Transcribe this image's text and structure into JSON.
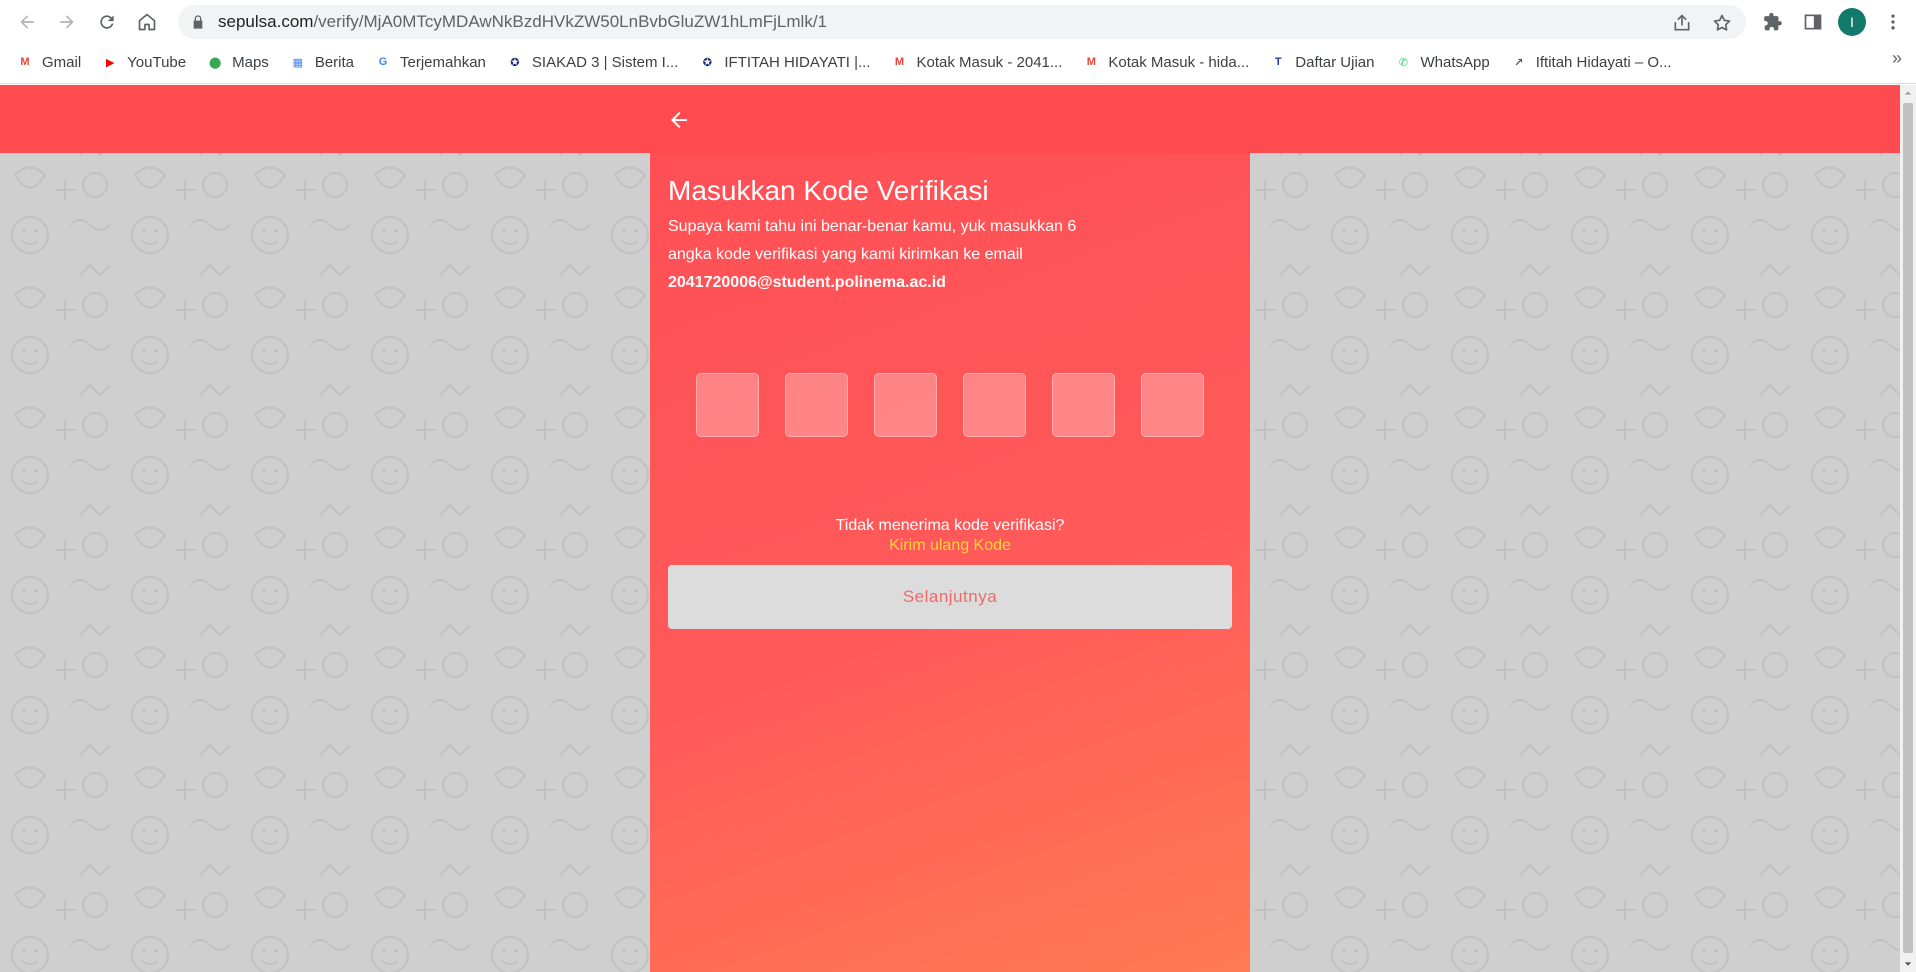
{
  "browser": {
    "url_domain": "sepulsa.com",
    "url_path": "/verify/MjA0MTcyMDAwNkBzdHVkZW50LnBvbGluZW1hLmFjLmlk/1",
    "profile_initial": "I",
    "icons": {
      "back": "arrow-left-icon",
      "forward": "arrow-right-icon",
      "reload": "reload-icon",
      "home": "home-icon",
      "lock": "lock-icon",
      "share": "share-icon",
      "star": "star-icon",
      "extensions": "puzzle-icon",
      "side_panel": "side-panel-icon",
      "menu": "kebab-menu-icon"
    }
  },
  "bookmarks": [
    {
      "label": "Gmail",
      "icon": "gmail-icon",
      "color": "#ea4335"
    },
    {
      "label": "YouTube",
      "icon": "youtube-icon",
      "color": "#ff0000"
    },
    {
      "label": "Maps",
      "icon": "maps-icon",
      "color": "#34a853"
    },
    {
      "label": "Berita",
      "icon": "news-icon",
      "color": "#4285f4"
    },
    {
      "label": "Terjemahkan",
      "icon": "translate-icon",
      "color": "#4285f4"
    },
    {
      "label": "SIAKAD 3 | Sistem I...",
      "icon": "siakad-icon",
      "color": "#1a237e"
    },
    {
      "label": "IFTITAH HIDAYATI |...",
      "icon": "siakad-icon",
      "color": "#1a237e"
    },
    {
      "label": "Kotak Masuk - 2041...",
      "icon": "gmail-icon",
      "color": "#ea4335"
    },
    {
      "label": "Kotak Masuk - hida...",
      "icon": "gmail-icon",
      "color": "#ea4335"
    },
    {
      "label": "Daftar Ujian",
      "icon": "te-icon",
      "color": "#1a3ca8"
    },
    {
      "label": "WhatsApp",
      "icon": "whatsapp-icon",
      "color": "#25d366"
    },
    {
      "label": "Iftitah Hidayati – O...",
      "icon": "link-icon",
      "color": "#555555"
    }
  ],
  "page": {
    "title": "Masukkan Kode Verifikasi",
    "description": "Supaya kami tahu ini benar-benar kamu, yuk masukkan 6 angka kode verifikasi yang kami kirimkan ke email",
    "email": "2041720006@student.polinema.ac.id",
    "otp_count": 6,
    "otp_values": [
      "",
      "",
      "",
      "",
      "",
      ""
    ],
    "resend_question": "Tidak menerima kode verifikasi?",
    "resend_link": "Kirim ulang Kode",
    "next_button": "Selanjutnya",
    "colors": {
      "header": "#ff4a4f",
      "panel_start": "#ff4f55",
      "panel_end": "#ff7a52",
      "link": "#ffd43b",
      "button_bg": "#dcdcdc",
      "button_text": "#ef6b6b",
      "background": "#cfcfcf"
    }
  }
}
